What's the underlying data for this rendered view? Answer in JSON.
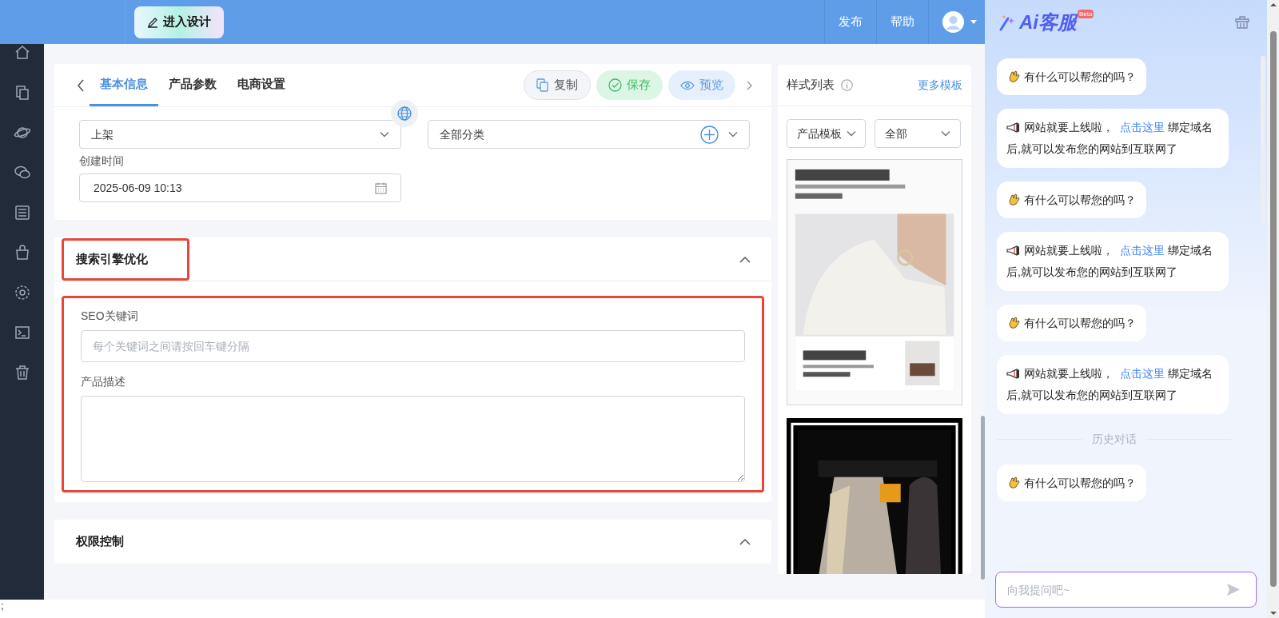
{
  "header": {
    "design_button": "进入设计",
    "nav": [
      "发布",
      "帮助"
    ]
  },
  "editor": {
    "tabs": [
      {
        "label": "基本信息",
        "selected": true
      },
      {
        "label": "产品参数",
        "selected": false
      },
      {
        "label": "电商设置",
        "selected": false
      }
    ],
    "actions": [
      {
        "kind": "copy",
        "label": "复制"
      },
      {
        "kind": "save",
        "label": "保存"
      },
      {
        "kind": "preview",
        "label": "预览"
      }
    ],
    "status_value": "上架",
    "category_value": "全部分类",
    "created_label": "创建时间",
    "created_value": "2025-06-09 10:13"
  },
  "sections": [
    {
      "title": "搜索引擎优化",
      "highlighted": true,
      "fields": [
        {
          "kind": "input",
          "label": "SEO关键词",
          "placeholder": "每个关键词之间请按回车键分隔"
        },
        {
          "kind": "textarea",
          "label": "产品描述"
        }
      ]
    },
    {
      "title": "权限控制",
      "highlighted": false
    }
  ],
  "style_panel": {
    "title": "样式列表",
    "more_link": "更多模板",
    "filters": [
      "产品模板",
      "全部"
    ],
    "templates": [
      {
        "kind": "picture"
      },
      {
        "kind": "picture"
      }
    ]
  },
  "chat": {
    "title": "Ai客服",
    "badge": "Beta",
    "messages": [
      {
        "kind": "greeting",
        "text": "有什么可以帮您的吗？"
      },
      {
        "kind": "notice",
        "before": "网站就要上线啦，",
        "link": "点击这里",
        "after": "绑定域名后,就可以发布您的网站到互联网了"
      },
      {
        "kind": "greeting",
        "text": "有什么可以帮您的吗？"
      },
      {
        "kind": "notice",
        "before": "网站就要上线啦，",
        "link": "点击这里",
        "after": "绑定域名后,就可以发布您的网站到互联网了"
      },
      {
        "kind": "greeting",
        "text": "有什么可以帮您的吗？"
      },
      {
        "kind": "notice",
        "before": "网站就要上线啦，",
        "link": "点击这里",
        "after": "绑定域名后,就可以发布您的网站到互联网了"
      },
      {
        "kind": "divider",
        "text": "历史对话"
      },
      {
        "kind": "greeting",
        "text": "有什么可以帮您的吗？"
      }
    ],
    "input_placeholder": "向我提问吧~"
  },
  "footer_text": ";"
}
